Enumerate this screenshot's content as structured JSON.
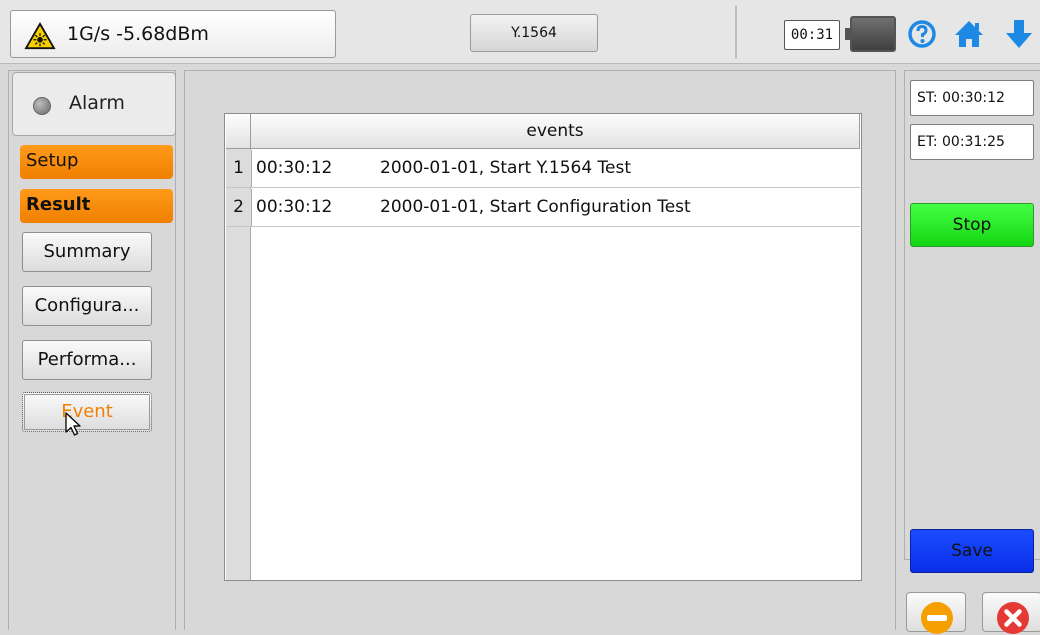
{
  "topbar": {
    "signal_text": "1G/s -5.68dBm",
    "mode_label": "Y.1564",
    "clock": "00:31",
    "icons": [
      "laser-warning-icon",
      "battery-icon",
      "help-icon",
      "home-icon",
      "down-arrow-icon"
    ]
  },
  "sidebar": {
    "alarm_label": "Alarm",
    "setup_label": "Setup",
    "result_label": "Result",
    "items": [
      {
        "label": "Summary"
      },
      {
        "label": "Configura..."
      },
      {
        "label": "Performa..."
      },
      {
        "label": "Event"
      }
    ]
  },
  "table": {
    "header": "events",
    "rows": [
      {
        "num": "1",
        "time": "00:30:12",
        "event": "2000-01-01, Start Y.1564 Test"
      },
      {
        "num": "2",
        "time": "00:30:12",
        "event": "2000-01-01, Start Configuration Test"
      }
    ]
  },
  "right": {
    "st": "ST: 00:30:12",
    "et": "ET: 00:31:25",
    "stop_label": "Stop",
    "save_label": "Save"
  },
  "colors": {
    "orange_tab": "#f08000",
    "stop_green": "#14d614",
    "save_blue": "#0a2ee8",
    "icon_blue": "#1e88e5",
    "close_red": "#e53935",
    "minimize_orange": "#f5a000"
  }
}
